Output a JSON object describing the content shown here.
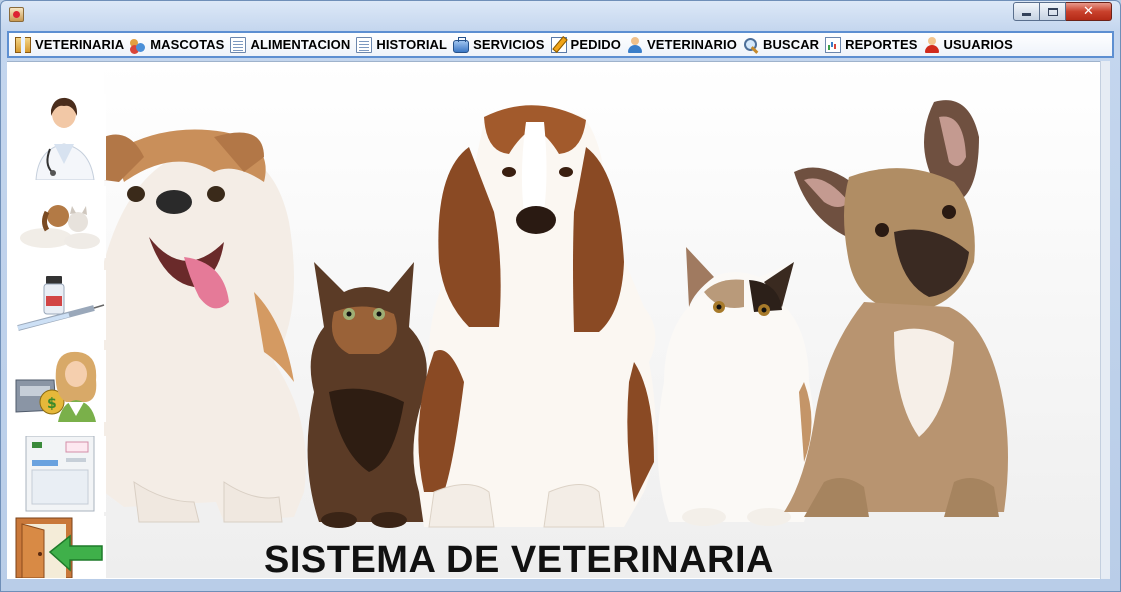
{
  "window": {
    "title": "",
    "controls": {
      "minimize": "minimize",
      "maximize": "maximize",
      "close": "✕"
    }
  },
  "menu": {
    "items": [
      {
        "label": "VETERINARIA",
        "icon": "box-icon"
      },
      {
        "label": "MASCOTAS",
        "icon": "people-icon"
      },
      {
        "label": "ALIMENTACION",
        "icon": "document-icon"
      },
      {
        "label": "HISTORIAL",
        "icon": "document-icon"
      },
      {
        "label": "SERVICIOS",
        "icon": "briefcase-icon"
      },
      {
        "label": "PEDIDO",
        "icon": "edit-icon"
      },
      {
        "label": "VETERINARIO",
        "icon": "person-icon"
      },
      {
        "label": "BUSCAR",
        "icon": "search-icon"
      },
      {
        "label": "REPORTES",
        "icon": "report-icon"
      },
      {
        "label": "USUARIOS",
        "icon": "user-icon"
      }
    ]
  },
  "sidebar": {
    "buttons": [
      {
        "name": "veterinarian",
        "icon": "doctor-icon"
      },
      {
        "name": "pets",
        "icon": "pets-icon"
      },
      {
        "name": "vaccines",
        "icon": "vaccine-icon"
      },
      {
        "name": "cashier",
        "icon": "cashier-icon"
      },
      {
        "name": "form",
        "icon": "form-icon"
      },
      {
        "name": "exit",
        "icon": "exit-door-icon"
      }
    ]
  },
  "main": {
    "title": "SISTEMA DE VETERINARIA",
    "image": "dogs-and-cats-photo"
  },
  "colors": {
    "menu_border": "#5d8fd1",
    "window_frame": "#b9cde8",
    "close_button": "#c9412c",
    "background": "#ffffff"
  }
}
